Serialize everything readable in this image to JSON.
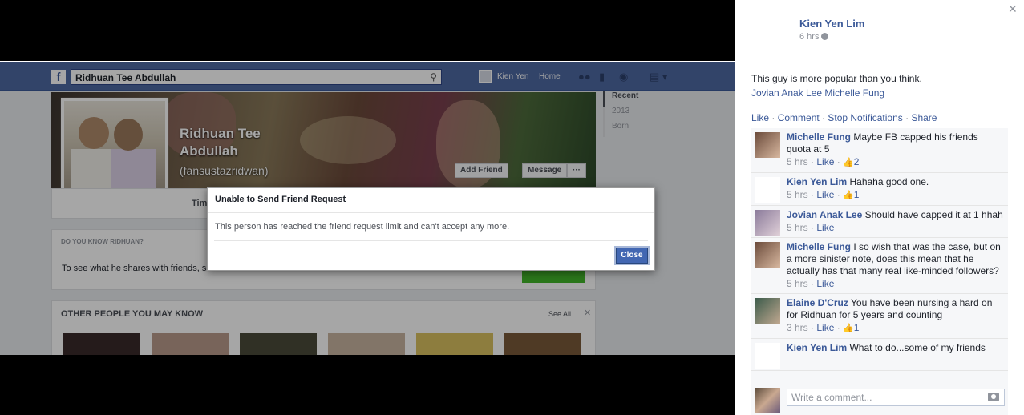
{
  "viewer": {
    "topbar": {
      "logo": "f",
      "search_value": "Ridhuan Tee Abdullah",
      "user_name": "Kien Yen",
      "home_label": "Home"
    },
    "profile": {
      "name": "Ridhuan Tee Abdullah",
      "handle": "(fansustazridwan)",
      "add_friend_label": "Add Friend",
      "message_label": "Message",
      "more_label": "···",
      "timeline_tab": "Tim",
      "timeline_nav": [
        "Recent",
        "2013",
        "Born"
      ]
    },
    "know_card": {
      "header": "DO YOU KNOW RIDHUAN?",
      "text": "To see what he shares with friends, s"
    },
    "people_card": {
      "header": "OTHER PEOPLE YOU MAY KNOW",
      "see_all": "See All",
      "close": "✕"
    },
    "dialog": {
      "title": "Unable to Send Friend Request",
      "body": "This person has reached the friend request limit and can't accept any more.",
      "close_label": "Close"
    }
  },
  "sidebar": {
    "close": "✕",
    "author": "Kien Yen Lim",
    "time": "6 hrs",
    "post_text": "This guy is more popular than you think.",
    "tags": "Jovian Anak Lee Michelle Fung",
    "actions": [
      "Like",
      "Comment",
      "Stop Notifications",
      "Share"
    ],
    "comments": [
      {
        "name": "Michelle Fung",
        "text": "Maybe FB capped his friends quota at 5",
        "time": "5 hrs",
        "like": "Like",
        "likes": "2"
      },
      {
        "name": "Kien Yen Lim",
        "text": "Hahaha good one.",
        "time": "5 hrs",
        "like": "Like",
        "likes": "1"
      },
      {
        "name": "Jovian Anak Lee",
        "text": "Should have capped it at 1 hhah",
        "time": "5 hrs",
        "like": "Like",
        "likes": ""
      },
      {
        "name": "Michelle Fung",
        "text": "I so wish that was the case, but on a more sinister note, does this mean that he actually has that many real like-minded followers?",
        "time": "5 hrs",
        "like": "Like",
        "likes": ""
      },
      {
        "name": "Elaine D'Cruz",
        "text": "You have been nursing a hard on for Ridhuan for 5 years and counting",
        "time": "3 hrs",
        "like": "Like",
        "likes": "1"
      },
      {
        "name": "Kien Yen Lim",
        "text": "What to do...some of my friends",
        "time": "",
        "like": "",
        "likes": ""
      }
    ],
    "write_placeholder": "Write a comment..."
  },
  "colors": {
    "fb_blue": "#3b5998",
    "topbar": "#4e69a2",
    "button_blue": "#4267b2"
  }
}
